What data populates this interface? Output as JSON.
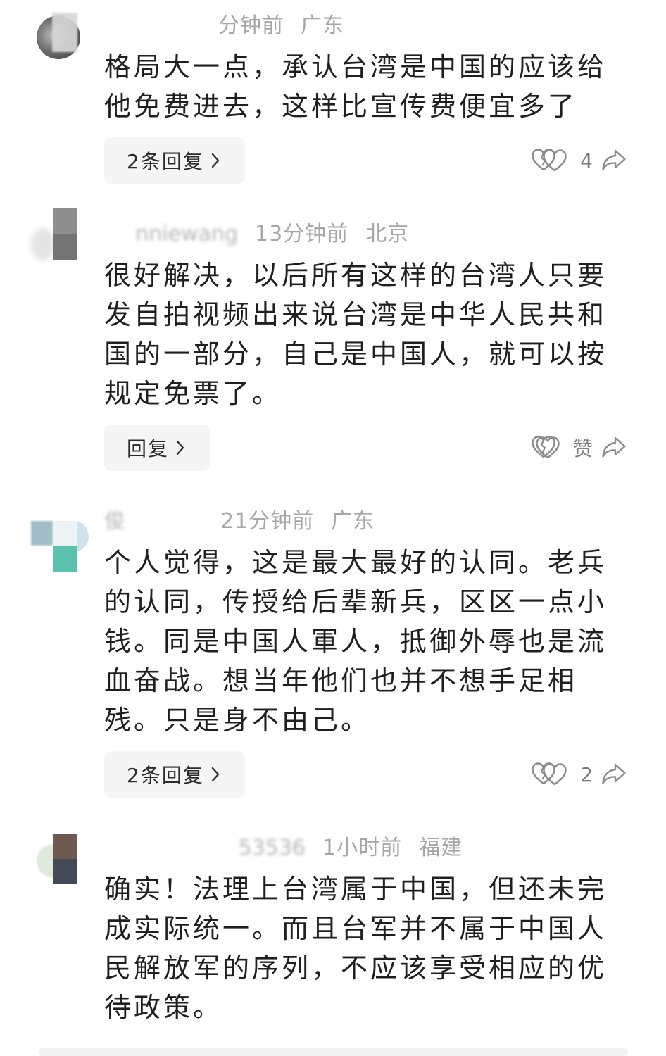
{
  "comments": [
    {
      "time": "分钟前",
      "location": "广东",
      "lines": [
        "格局大一点，承认台湾是中国的应该给",
        "他免费进去，这样比宣传费便宜多了"
      ],
      "reply_label": "2条回复",
      "like_label": "4"
    },
    {
      "username": "nniewang",
      "time": "13分钟前",
      "location": "北京",
      "lines": [
        "很好解决，以后所有这样的台湾人只要",
        "发自拍视频出来说台湾是中华人民共和",
        "国的一部分，自己是中国人，就可以按",
        "规定免票了。"
      ],
      "reply_label": "回复",
      "like_label": "赞"
    },
    {
      "username": "俊",
      "time": "21分钟前",
      "location": "广东",
      "lines": [
        "个人觉得，这是最大最好的认同。老兵",
        "的认同，传授给后辈新兵，区区一点小",
        "钱。同是中国人軍人，抵御外辱也是流",
        "血奋战。想当年他们也并不想手足相",
        "残。只是身不由己。"
      ],
      "reply_label": "2条回复",
      "like_label": "2"
    },
    {
      "username": "53536",
      "time": "1小时前",
      "location": "福建",
      "lines": [
        "确实！法理上台湾属于中国，但还未完",
        "成实际统一。而且台军并不属于中国人",
        "民解放军的序列，不应该享受相应的优",
        "待政策。"
      ]
    }
  ],
  "icons": {
    "like": "heart-outline-icon",
    "dislike": "broken-heart-icon",
    "share": "share-arrow-icon",
    "reply_more": "chevron-right-icon"
  },
  "colors": {
    "text": "#1f1f1f",
    "meta": "#a6a6a6",
    "icon": "#8a8a8a",
    "pill_bg": "#f5f5f5",
    "page_bg": "#ffffff"
  }
}
